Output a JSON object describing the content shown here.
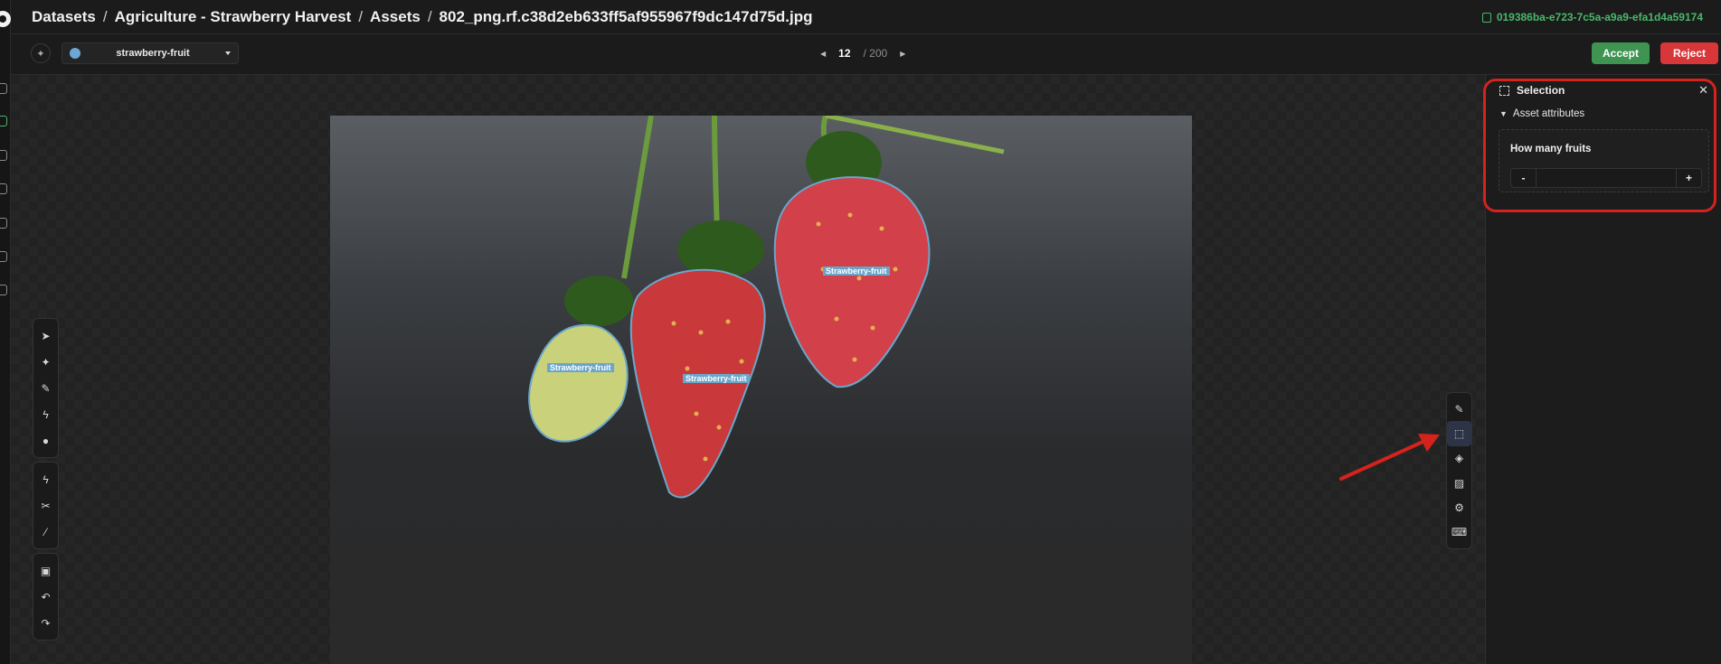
{
  "app": {
    "brand_color": "#49b86a"
  },
  "nav_rail": {
    "items": [
      "datasets-icon",
      "images-icon",
      "annotations-icon",
      "layers-icon",
      "upload-icon",
      "settings-icon",
      "signpost-icon"
    ]
  },
  "breadcrumb": {
    "items": [
      "Datasets",
      "Agriculture - Strawberry Harvest",
      "Assets",
      "802_png.rf.c38d2eb633ff5af955967f9dc147d75d.jpg"
    ],
    "separator": "/"
  },
  "asset_id": "019386ba-e723-7c5a-a9a9-efa1d4a59174",
  "class_selector": {
    "value": "strawberry-fruit",
    "color": "#6ea7d3"
  },
  "pager": {
    "current": "12",
    "total": "/ 200"
  },
  "actions": {
    "accept": "Accept",
    "reject": "Reject",
    "accept_color": "#3f9452",
    "reject_color": "#d9363a"
  },
  "canvas": {
    "labels": [
      "Strawberry-fruit",
      "Strawberry-fruit",
      "Strawberry-fruit"
    ]
  },
  "left_tools": {
    "group1": [
      "pointer-icon",
      "pin-icon",
      "pencil-icon",
      "magic-wand-icon",
      "point-icon"
    ],
    "group2": [
      "bolt-icon",
      "scissors-icon",
      "brush-icon"
    ],
    "group3": [
      "save-icon",
      "undo-icon",
      "redo-icon"
    ]
  },
  "right_tools": [
    "edit-icon",
    "selection-icon",
    "layers-icon",
    "image-icon",
    "settings-icon",
    "keyboard-icon"
  ],
  "panel": {
    "title": "Selection",
    "section": "Asset attributes",
    "attribute_label": "How many fruits",
    "minus": "-",
    "plus": "+",
    "value": ""
  }
}
